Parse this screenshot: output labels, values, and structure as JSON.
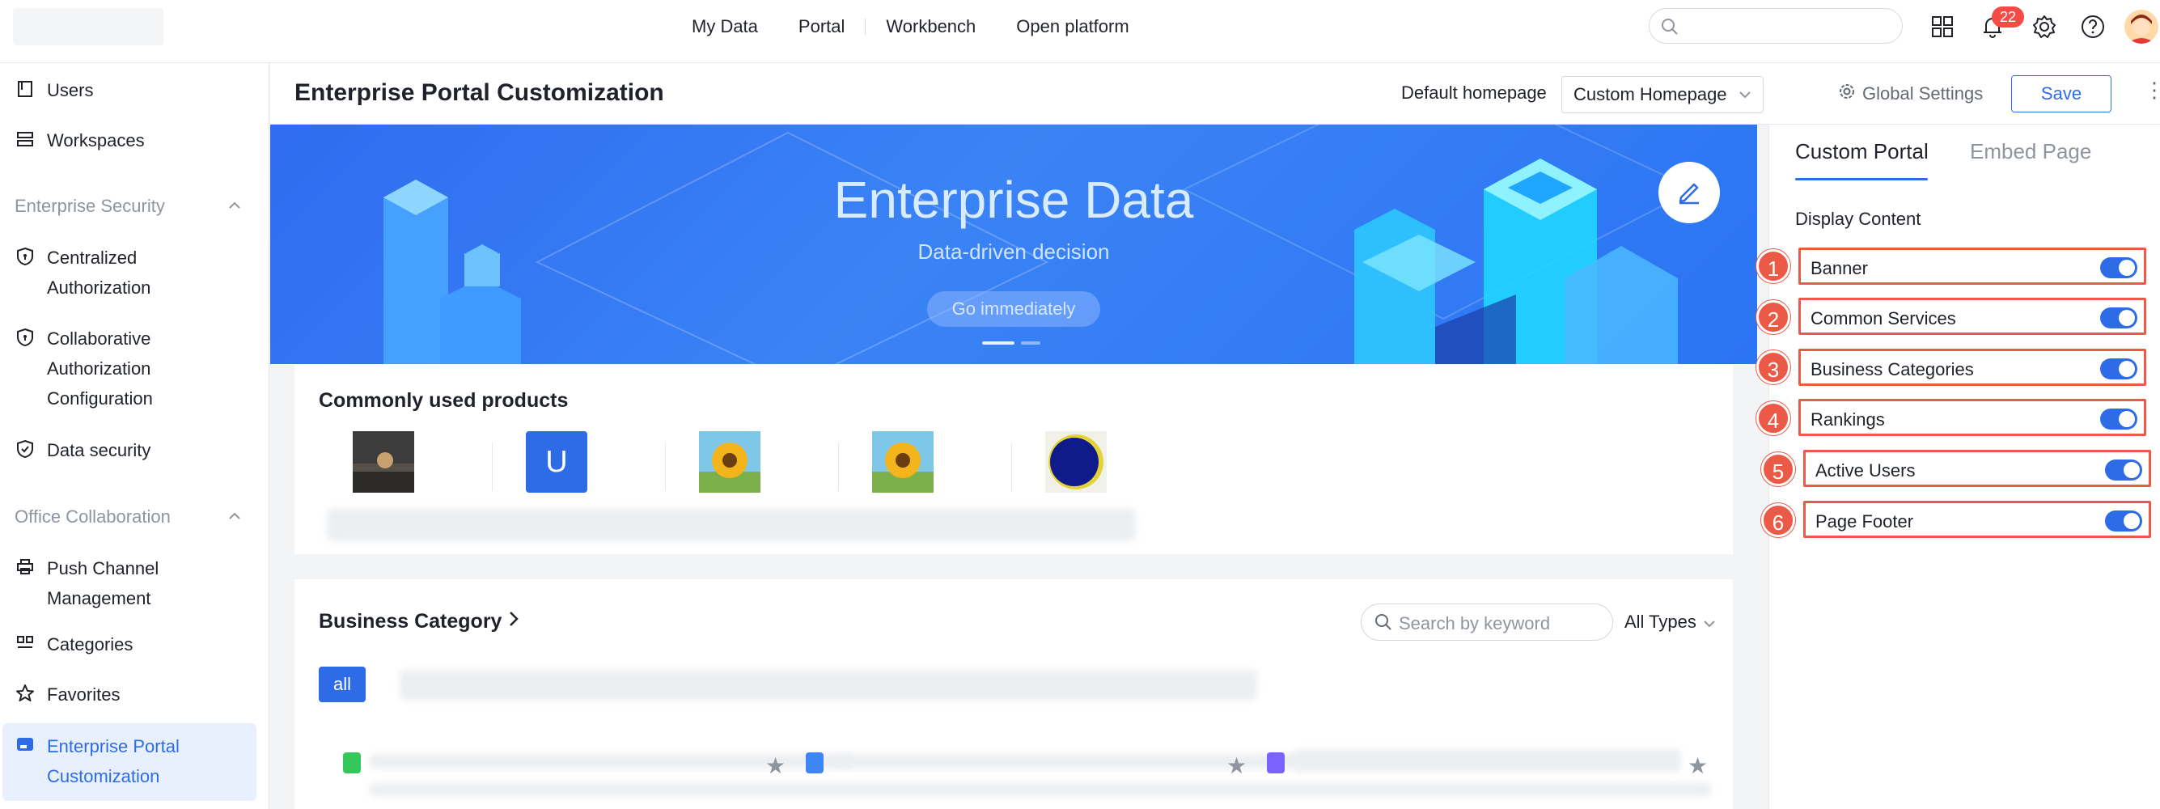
{
  "topbar": {
    "nav": [
      "My Data",
      "Portal",
      "Workbench",
      "Open platform"
    ],
    "notifications_count": "22",
    "icons": [
      "grid-icon",
      "bell-icon",
      "gear-icon",
      "help-icon"
    ]
  },
  "sidebar": {
    "items_top": [
      {
        "label": "Users",
        "icon": "bookmark-icon"
      },
      {
        "label": "Workspaces",
        "icon": "stack-icon"
      }
    ],
    "group_security": "Enterprise Security",
    "security_items": [
      {
        "line1": "Centralized",
        "line2": "Authorization",
        "icon": "shield-lock-icon"
      },
      {
        "line1": "Collaborative",
        "line2": "Authorization",
        "line3": "Configuration",
        "icon": "shield-lock-icon"
      },
      {
        "line1": "Data security",
        "icon": "shield-check-icon"
      }
    ],
    "group_office": "Office Collaboration",
    "office_items": [
      {
        "line1": "Push Channel",
        "line2": "Management",
        "icon": "printer-icon"
      },
      {
        "line1": "Categories",
        "icon": "categories-icon"
      },
      {
        "line1": "Favorites",
        "icon": "star-outline-icon"
      },
      {
        "line1": "Enterprise Portal",
        "line2": "Customization",
        "icon": "portal-icon",
        "active": true
      }
    ]
  },
  "header": {
    "title": "Enterprise Portal Customization",
    "default_homepage_label": "Default homepage",
    "default_homepage_value": "Custom Homepage",
    "global_settings": "Global Settings",
    "save": "Save"
  },
  "banner": {
    "title": "Enterprise Data",
    "subtitle": "Data-driven decision",
    "button": "Go immediately"
  },
  "common_products": {
    "title": "Commonly used products",
    "tile_letter": "U"
  },
  "business_category": {
    "title": "Business Category",
    "search_placeholder": "Search by keyword",
    "type_filter": "All Types",
    "all_tab": "all"
  },
  "right_panel": {
    "tabs": [
      "Custom Portal",
      "Embed Page"
    ],
    "display_content": "Display Content",
    "options": [
      {
        "num": "1",
        "label": "Banner",
        "enabled": true
      },
      {
        "num": "2",
        "label": "Common Services",
        "enabled": true
      },
      {
        "num": "3",
        "label": "Business Categories",
        "enabled": true
      },
      {
        "num": "4",
        "label": "Rankings",
        "enabled": true
      },
      {
        "num": "5",
        "label": "Active Users",
        "enabled": true
      },
      {
        "num": "6",
        "label": "Page Footer",
        "enabled": true
      }
    ]
  },
  "colors": {
    "accent": "#2e6be6",
    "highlight": "#ea5a46",
    "badge": "#f54a45"
  }
}
